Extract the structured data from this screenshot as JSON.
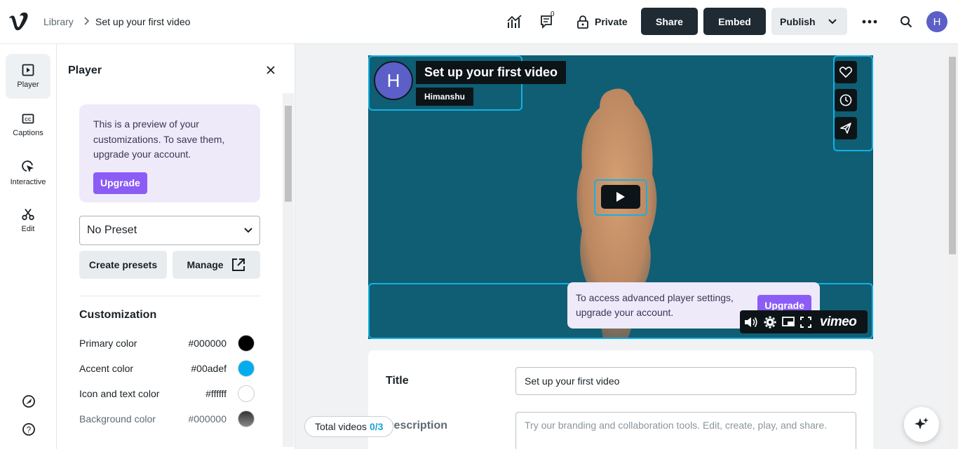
{
  "header": {
    "breadcrumb_library": "Library",
    "breadcrumb_current": "Set up your first video",
    "comments_count": "0",
    "privacy_label": "Private",
    "share_label": "Share",
    "embed_label": "Embed",
    "publish_label": "Publish",
    "avatar_initial": "H"
  },
  "rail": {
    "items": [
      {
        "label": "Player",
        "icon": "player-icon"
      },
      {
        "label": "Captions",
        "icon": "cc-icon"
      },
      {
        "label": "Interactive",
        "icon": "cursor-click-icon"
      },
      {
        "label": "Edit",
        "icon": "scissors-icon"
      }
    ]
  },
  "panel": {
    "title": "Player",
    "promo_text": "This is a preview of your customizations. To save them, upgrade your account.",
    "promo_button": "Upgrade",
    "preset_value": "No Preset",
    "create_presets_label": "Create presets",
    "manage_label": "Manage",
    "customization_title": "Customization",
    "colors": [
      {
        "label": "Primary color",
        "hex": "#000000",
        "swatch": "#000000"
      },
      {
        "label": "Accent color",
        "hex": "#00adef",
        "swatch": "#00adef"
      },
      {
        "label": "Icon and text color",
        "hex": "#ffffff",
        "swatch": "#ffffff"
      },
      {
        "label": "Background color",
        "hex": "#000000",
        "swatch": "#000000"
      }
    ]
  },
  "video": {
    "avatar_initial": "H",
    "title": "Set up your first video",
    "author": "Himanshu",
    "brand": "vimeo",
    "upsell_text": "To access advanced player settings, upgrade your account.",
    "upsell_button": "Upgrade"
  },
  "details": {
    "title_label": "Title",
    "title_value": "Set up your first video",
    "description_label": "Description",
    "description_placeholder": "Try our branding and collaboration tools. Edit, create, play, and share."
  },
  "total_videos": {
    "label": "Total videos",
    "value": "0/3"
  },
  "colors": {
    "accent": "#16b0e2",
    "upgrade": "#8b5cf6",
    "dark_button": "#1f2a33"
  }
}
